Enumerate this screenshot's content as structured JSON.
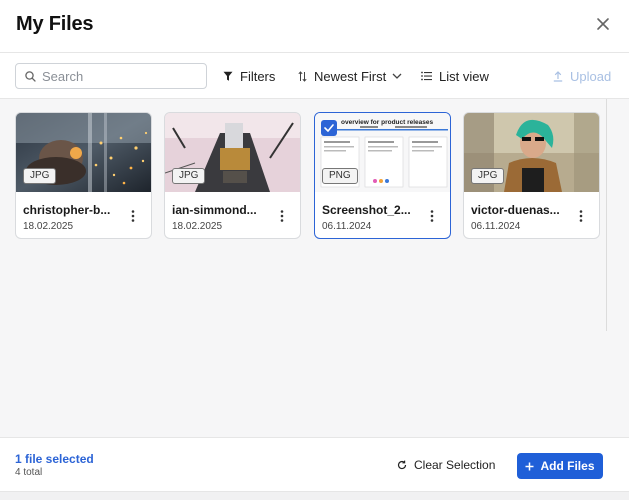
{
  "header": {
    "title": "My Files",
    "close_icon": "close-icon"
  },
  "toolbar": {
    "search_placeholder": "Search",
    "filters_label": "Filters",
    "sort_label": "Newest First",
    "view_label": "List view",
    "upload_label": "Upload"
  },
  "files": [
    {
      "type": "JPG",
      "name": "christopher-b...",
      "date": "18.02.2025",
      "selected": false
    },
    {
      "type": "JPG",
      "name": "ian-simmond...",
      "date": "18.02.2025",
      "selected": false
    },
    {
      "type": "PNG",
      "name": "Screenshot_2...",
      "date": "06.11.2024",
      "selected": true,
      "preview_title": "overview for product releases"
    },
    {
      "type": "JPG",
      "name": "victor-duenas...",
      "date": "06.11.2024",
      "selected": false
    }
  ],
  "footer": {
    "selected_text": "1 file selected",
    "total_text": "4 total",
    "clear_label": "Clear Selection",
    "add_label": "Add Files"
  },
  "colors": {
    "accent": "#1f5fd8",
    "selected_border": "#2c64d6",
    "upload_disabled": "#a9c0e3"
  }
}
